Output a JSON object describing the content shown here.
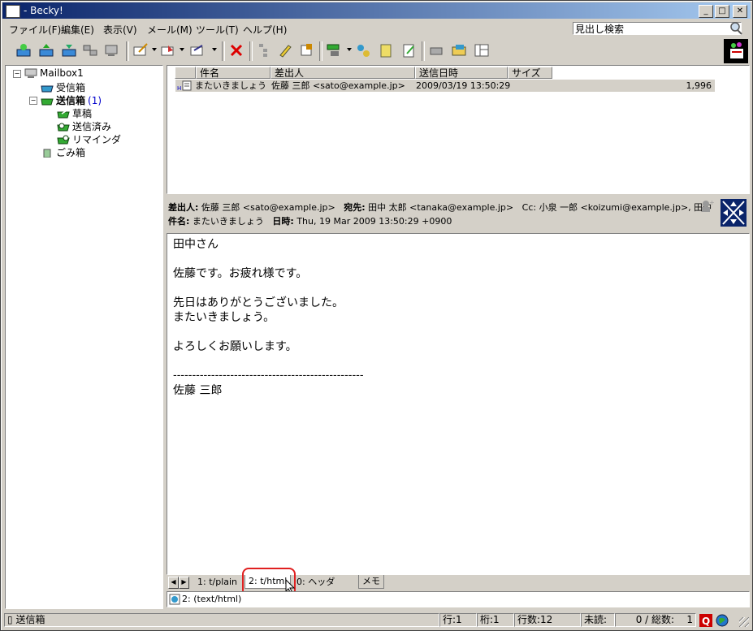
{
  "window": {
    "title": "- Becky!"
  },
  "menu": [
    "ファイル(F)",
    "編集(E)",
    "表示(V)",
    "メール(M)",
    "ツール(T)",
    "ヘルプ(H)"
  ],
  "search": {
    "value": "見出し検索"
  },
  "folders": {
    "root": "Mailbox1",
    "inbox": "受信箱",
    "outbox": "送信箱",
    "outbox_count": "(1)",
    "drafts": "草稿",
    "sent": "送信済み",
    "reminder": "リマインダ",
    "trash": "ごみ箱"
  },
  "list": {
    "columns": [
      "件名",
      "差出人",
      "送信日時",
      "サイズ"
    ],
    "rows": [
      {
        "subject": "またいきましょう",
        "from": "佐藤 三郎 <sato@example.jp>",
        "date": "2009/03/19 13:50:29",
        "size": "1,996"
      }
    ]
  },
  "header": {
    "from_label": "差出人:",
    "from_value": "佐藤 三郎 <sato@example.jp>",
    "to_label": "宛先:",
    "to_value": "田中 太郎 <tanaka@example.jp>",
    "cc_label": "Cc:",
    "cc_value": "小泉 一郎 <koizumi@example.jp>, 田中",
    "subject_label": "件名:",
    "subject_value": "またいきましょう",
    "date_label": "日時:",
    "date_value": "Thu, 19 Mar 2009 13:50:29 +0900"
  },
  "body": [
    "田中さん",
    "佐藤です。お疲れ様です。",
    "先日はありがとうございました。",
    "またいきましょう。",
    "よろしくお願いします。",
    "--------------------------------------------------",
    "佐藤 三郎"
  ],
  "tabs": [
    "1: t/plain",
    "2: t/html",
    "0: ヘッダ",
    "メモ"
  ],
  "attachment": {
    "label": "2: (text/html)"
  },
  "status": {
    "folder": "送信箱",
    "line": "行:1",
    "col": "桁:1",
    "lines": "行数:12",
    "unread": "未読:",
    "counts": "0 / 総数:",
    "total": "1"
  },
  "colors": {
    "title_start": "#0a246a",
    "title_end": "#a6caf0",
    "highlight": "#e02020"
  }
}
